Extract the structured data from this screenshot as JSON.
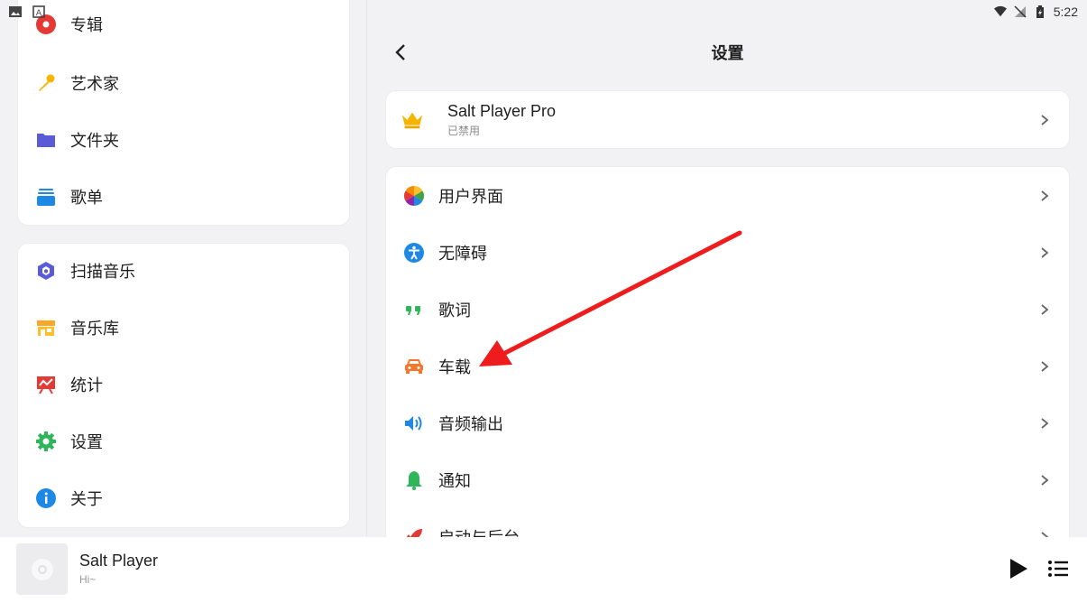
{
  "status_bar": {
    "time": "5:22"
  },
  "sidebar": {
    "library_items": [
      {
        "label": "专辑",
        "icon": "album-icon"
      },
      {
        "label": "艺术家",
        "icon": "microphone-icon"
      },
      {
        "label": "文件夹",
        "icon": "folder-icon"
      },
      {
        "label": "歌单",
        "icon": "playlist-icon"
      }
    ],
    "tool_items": [
      {
        "label": "扫描音乐",
        "icon": "scan-icon"
      },
      {
        "label": "音乐库",
        "icon": "store-icon"
      },
      {
        "label": "统计",
        "icon": "statistics-icon"
      },
      {
        "label": "设置",
        "icon": "gear-icon"
      },
      {
        "label": "关于",
        "icon": "info-icon"
      }
    ]
  },
  "settings": {
    "title": "设置",
    "pro": {
      "title": "Salt Player Pro",
      "subtitle": "已禁用"
    },
    "items": [
      {
        "label": "用户界面",
        "icon": "color-wheel-icon"
      },
      {
        "label": "无障碍",
        "icon": "accessibility-icon"
      },
      {
        "label": "歌词",
        "icon": "quote-icon"
      },
      {
        "label": "车载",
        "icon": "car-icon"
      },
      {
        "label": "音频输出",
        "icon": "speaker-icon"
      },
      {
        "label": "通知",
        "icon": "bell-icon"
      },
      {
        "label": "启动与后台",
        "icon": "rocket-icon"
      }
    ]
  },
  "player": {
    "title": "Salt Player",
    "subtitle": "Hi~"
  },
  "colors": {
    "accent_red": "#e53935",
    "annotation_arrow": "#ee1c1c",
    "folder": "#5b5bd6",
    "playlist": "#1e88e5",
    "settings_green": "#2fb55a"
  }
}
